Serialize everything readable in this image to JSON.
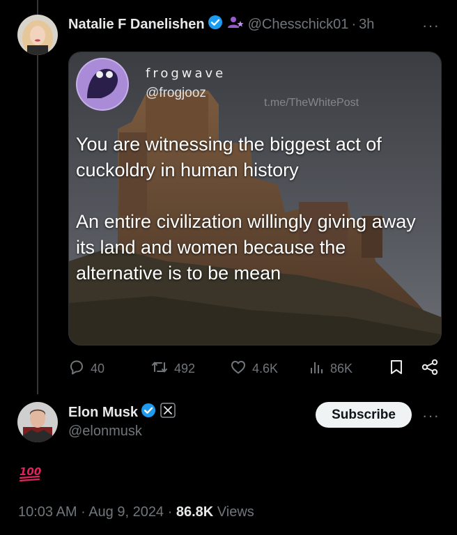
{
  "original_post": {
    "author_name": "Natalie F Danelishen",
    "handle": "@Chesschick01",
    "separator": "·",
    "time": "3h",
    "more_label": "···",
    "media": {
      "account_name": "frogwave",
      "account_handle": "@frogjooz",
      "watermark": "t.me/TheWhitePost",
      "paragraph_1": "You are witnessing the biggest act of cuckoldry in human history",
      "paragraph_2": "An entire civilization willingly giving away its land and women because the alternative is to be mean"
    },
    "stats": {
      "replies": "40",
      "reposts": "492",
      "likes": "4.6K",
      "views": "86K"
    }
  },
  "reply": {
    "author_name": "Elon Musk",
    "handle": "@elonmusk",
    "subscribe_label": "Subscribe",
    "more_label": "···",
    "content_emoji": "hundred-points-emoji"
  },
  "meta": {
    "time": "10:03 AM",
    "sep1": " · ",
    "date": "Aug 9, 2024",
    "sep2": " · ",
    "views_count": "86.8K",
    "views_label": " Views"
  },
  "colors": {
    "background": "#000000",
    "text": "#e7e9ea",
    "muted": "#71767b",
    "verified": "#1d9bf0",
    "emoji_red": "#e0245e"
  }
}
